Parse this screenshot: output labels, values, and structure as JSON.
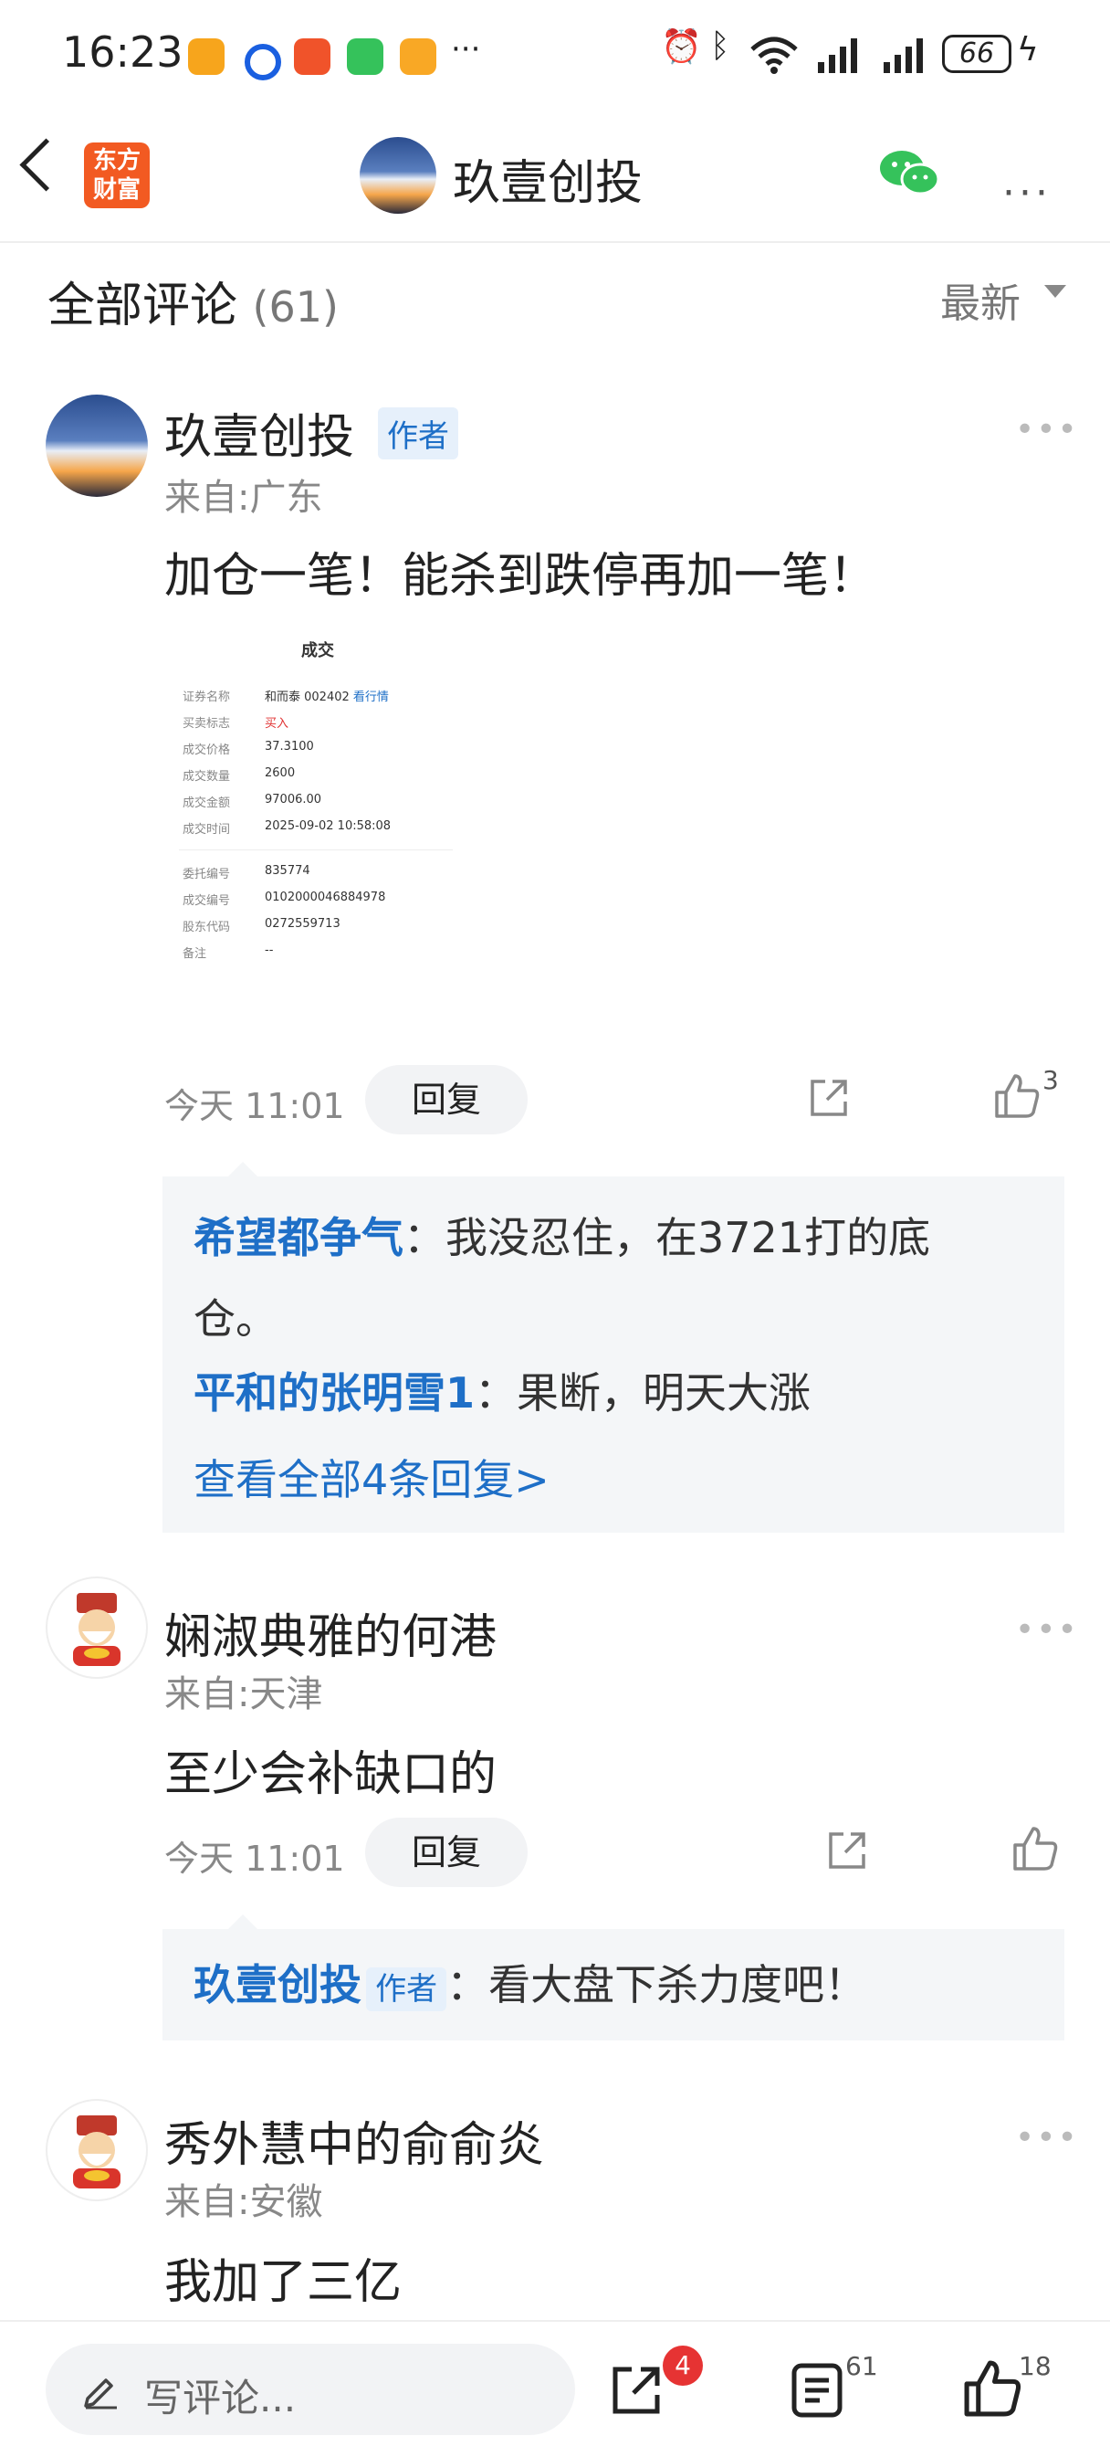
{
  "status_bar": {
    "time": "16:23",
    "battery": "66",
    "more_dots": "···"
  },
  "header": {
    "logo_line1": "东方",
    "logo_line2": "财富",
    "title": "玖壹创投",
    "more": "···"
  },
  "section": {
    "title": "全部评论",
    "count": "(61)",
    "sort": "最新"
  },
  "comments": [
    {
      "name": "玖壹创投",
      "badge": "作者",
      "from": "来自:广东",
      "text": "加仓一笔！能杀到跌停再加一笔！",
      "time": "今天 11:01",
      "reply_label": "回复",
      "likes": "3",
      "replies": [
        {
          "name": "希望都争气",
          "sep": "：",
          "text_line1": "我没忍住，在3721打的底",
          "text_line2": "仓。"
        },
        {
          "name": "平和的张明雪1",
          "sep": "：",
          "text_line1": "果断，明天大涨"
        }
      ],
      "view_all": "查看全部4条回复>",
      "trade": {
        "title": "成交",
        "rows": [
          {
            "label": "证券名称",
            "value": "和而泰 002402",
            "extra": "看行情"
          },
          {
            "label": "买卖标志",
            "value": "买入"
          },
          {
            "label": "成交价格",
            "value": "37.3100"
          },
          {
            "label": "成交数量",
            "value": "2600"
          },
          {
            "label": "成交金额",
            "value": "97006.00"
          },
          {
            "label": "成交时间",
            "value": "2025-09-02 10:58:08"
          },
          {
            "label": "委托编号",
            "value": "835774"
          },
          {
            "label": "成交编号",
            "value": "0102000046884978"
          },
          {
            "label": "股东代码",
            "value": "0272559713"
          },
          {
            "label": "备注",
            "value": "--"
          }
        ]
      }
    },
    {
      "name": "娴淑典雅的何港",
      "from": "来自:天津",
      "text": "至少会补缺口的",
      "time": "今天 11:01",
      "reply_label": "回复",
      "replies": [
        {
          "name": "玖壹创投",
          "badge": "作者",
          "sep": "：",
          "text_line1": "看大盘下杀力度吧！"
        }
      ]
    },
    {
      "name": "秀外慧中的俞俞炎",
      "from": "来自:安徽",
      "text": "我加了三亿"
    }
  ],
  "bottom_bar": {
    "placeholder": "写评论...",
    "share_badge": "4",
    "comment_count": "61",
    "like_count": "18"
  },
  "colors": {
    "accent_blue": "#1e6fc7",
    "logo_orange": "#f25a22",
    "badge_red": "#e63333"
  }
}
